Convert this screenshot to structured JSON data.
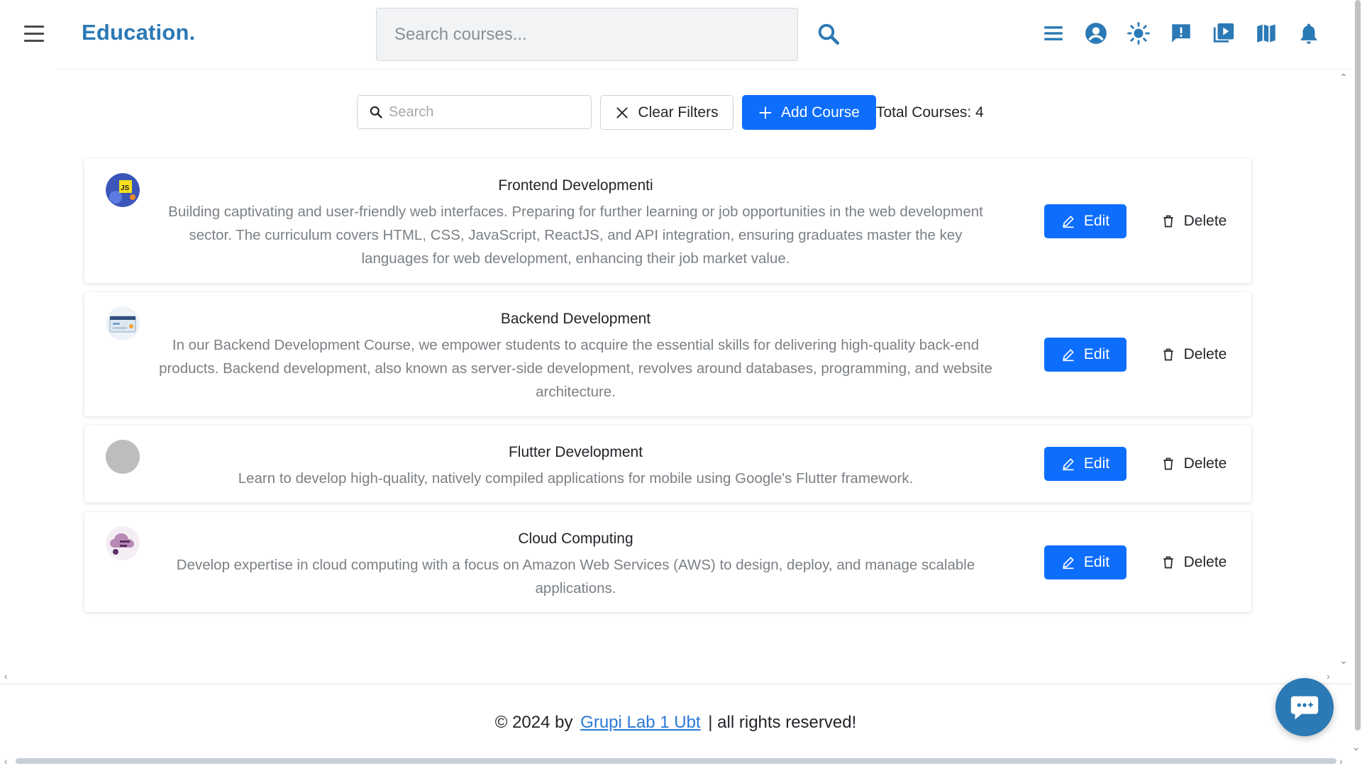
{
  "header": {
    "brand": "Education.",
    "search_placeholder": "Search courses...",
    "nav_icons": [
      "menu-lines-icon",
      "user-circle-icon",
      "sun-icon",
      "feedback-icon",
      "video-library-icon",
      "map-icon",
      "bell-icon"
    ]
  },
  "toolbar": {
    "search_placeholder": "Search",
    "clear_label": "Clear Filters",
    "add_label": "Add Course",
    "total_label": "Total Courses: 4"
  },
  "courses": [
    {
      "title": "Frontend Developmenti",
      "description": "Building captivating and user-friendly web interfaces. Preparing for further learning or job opportunities in the web development sector. The curriculum covers HTML, CSS, JavaScript, ReactJS, and API integration, ensuring graduates master the key languages for web development, enhancing their job market value.",
      "edit_label": "Edit",
      "delete_label": "Delete"
    },
    {
      "title": "Backend Development",
      "description": "In our Backend Development Course, we empower students to acquire the essential skills for delivering high-quality back-end products. Backend development, also known as server-side development, revolves around databases, programming, and website architecture.",
      "edit_label": "Edit",
      "delete_label": "Delete"
    },
    {
      "title": "Flutter Development",
      "description": "Learn to develop high-quality, natively compiled applications for mobile using Google's Flutter framework.",
      "edit_label": "Edit",
      "delete_label": "Delete"
    },
    {
      "title": "Cloud Computing",
      "description": "Develop expertise in cloud computing with a focus on Amazon Web Services (AWS) to design, deploy, and manage scalable applications.",
      "edit_label": "Edit",
      "delete_label": "Delete"
    }
  ],
  "footer": {
    "prefix": "© 2024 by",
    "link_text": "Grupi Lab 1 Ubt",
    "suffix": "| all rights reserved!"
  },
  "colors": {
    "brand": "#2b79b5",
    "primary_button": "#0d6efd",
    "muted_text": "#7b8085"
  }
}
